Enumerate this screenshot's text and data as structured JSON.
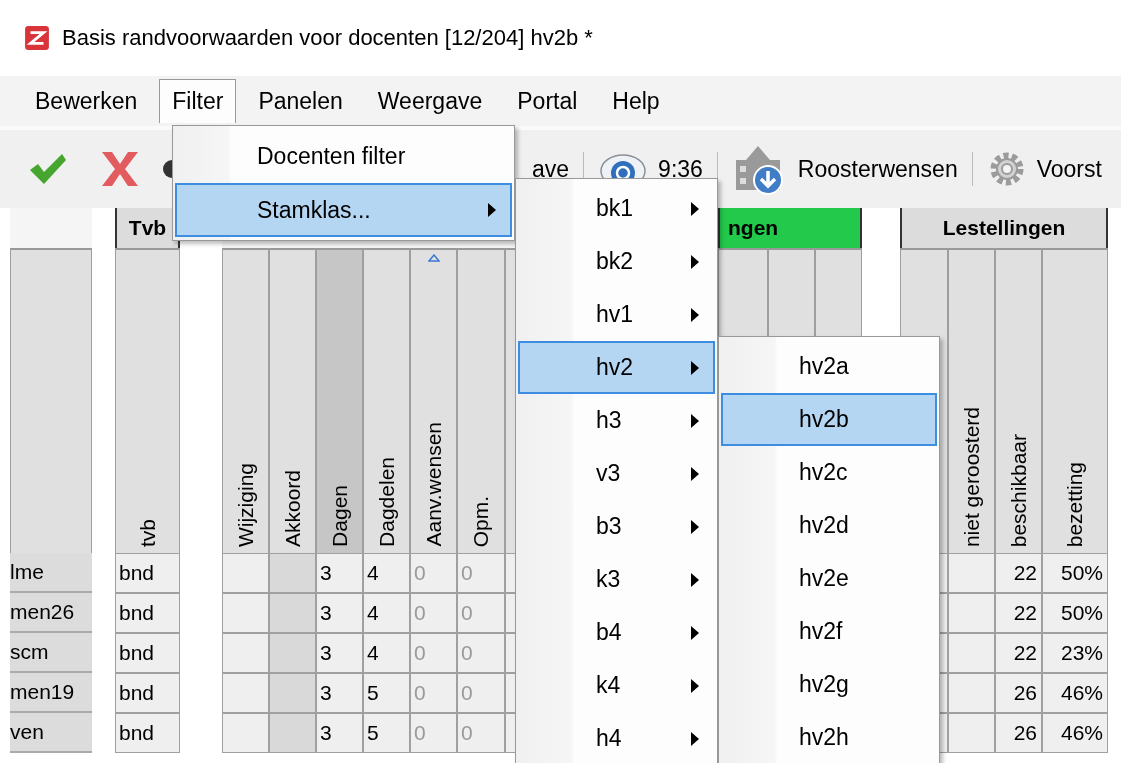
{
  "window": {
    "title": "Basis randvoorwaarden voor docenten [12/204] hv2b *"
  },
  "menubar": [
    {
      "label": "Bewerken",
      "selected": false
    },
    {
      "label": "Filter",
      "selected": true
    },
    {
      "label": "Panelen",
      "selected": false
    },
    {
      "label": "Weergave",
      "selected": false
    },
    {
      "label": "Portal",
      "selected": false
    },
    {
      "label": "Help",
      "selected": false
    }
  ],
  "toolbar": [
    {
      "kind": "text",
      "label": "ave"
    },
    {
      "kind": "sync",
      "label": "9:36"
    },
    {
      "kind": "wishes",
      "label": "Roosterwensen"
    },
    {
      "kind": "settings",
      "label": "Voorst"
    }
  ],
  "filter_menu": [
    {
      "label": "Docenten filter",
      "submenu": false,
      "selected": false
    },
    {
      "label": "Stamklas...",
      "submenu": true,
      "selected": true
    }
  ],
  "stamklas_menu": [
    {
      "label": "bk1",
      "submenu": true,
      "selected": false
    },
    {
      "label": "bk2",
      "submenu": true,
      "selected": false
    },
    {
      "label": "hv1",
      "submenu": true,
      "selected": false
    },
    {
      "label": "hv2",
      "submenu": true,
      "selected": true
    },
    {
      "label": "h3",
      "submenu": true,
      "selected": false
    },
    {
      "label": "v3",
      "submenu": true,
      "selected": false
    },
    {
      "label": "b3",
      "submenu": true,
      "selected": false
    },
    {
      "label": "k3",
      "submenu": true,
      "selected": false
    },
    {
      "label": "b4",
      "submenu": true,
      "selected": false
    },
    {
      "label": "k4",
      "submenu": true,
      "selected": false
    },
    {
      "label": "h4",
      "submenu": true,
      "selected": false
    }
  ],
  "class_menu": [
    {
      "label": "hv2a",
      "selected": false
    },
    {
      "label": "hv2b",
      "selected": true
    },
    {
      "label": "hv2c",
      "selected": false
    },
    {
      "label": "hv2d",
      "selected": false
    },
    {
      "label": "hv2e",
      "selected": false
    },
    {
      "label": "hv2f",
      "selected": false
    },
    {
      "label": "hv2g",
      "selected": false
    },
    {
      "label": "hv2h",
      "selected": false
    }
  ],
  "grid": {
    "groups": [
      {
        "label": "Tvb",
        "kind": "plain"
      },
      {
        "label": "ngen",
        "kind": "green"
      },
      {
        "label": "Lestellingen",
        "kind": "plain"
      }
    ],
    "columns": [
      {
        "label": "tvb",
        "selected": false,
        "sorted": false
      },
      {
        "label": "Wijziging",
        "selected": false,
        "sorted": false
      },
      {
        "label": "Akkoord",
        "selected": false,
        "sorted": false
      },
      {
        "label": "Dagen",
        "selected": true,
        "sorted": false
      },
      {
        "label": "Dagdelen",
        "selected": false,
        "sorted": false
      },
      {
        "label": "Aanv.wensen",
        "selected": false,
        "sorted": true
      },
      {
        "label": "Opm.",
        "selected": false,
        "sorted": false
      },
      {
        "label": "niet geroosterd",
        "selected": false,
        "sorted": false
      },
      {
        "label": "beschikbaar",
        "selected": false,
        "sorted": false
      },
      {
        "label": "bezetting",
        "selected": false,
        "sorted": false
      }
    ],
    "rows": [
      {
        "name": "lme",
        "tvb": "bnd",
        "dagen": "3",
        "dagdelen": "4",
        "aanv_wensen": "0",
        "opm": "0",
        "beschikbaar": "22",
        "bezetting": "50%"
      },
      {
        "name": "men26",
        "tvb": "bnd",
        "dagen": "3",
        "dagdelen": "4",
        "aanv_wensen": "0",
        "opm": "0",
        "beschikbaar": "22",
        "bezetting": "50%"
      },
      {
        "name": "scm",
        "tvb": "bnd",
        "dagen": "3",
        "dagdelen": "4",
        "aanv_wensen": "0",
        "opm": "0",
        "beschikbaar": "22",
        "bezetting": "23%"
      },
      {
        "name": "men19",
        "tvb": "bnd",
        "dagen": "3",
        "dagdelen": "5",
        "aanv_wensen": "0",
        "opm": "0",
        "beschikbaar": "26",
        "bezetting": "46%"
      },
      {
        "name": "ven",
        "tvb": "bnd",
        "dagen": "3",
        "dagdelen": "5",
        "aanv_wensen": "0",
        "opm": "0",
        "beschikbaar": "26",
        "bezetting": "46%"
      }
    ]
  }
}
